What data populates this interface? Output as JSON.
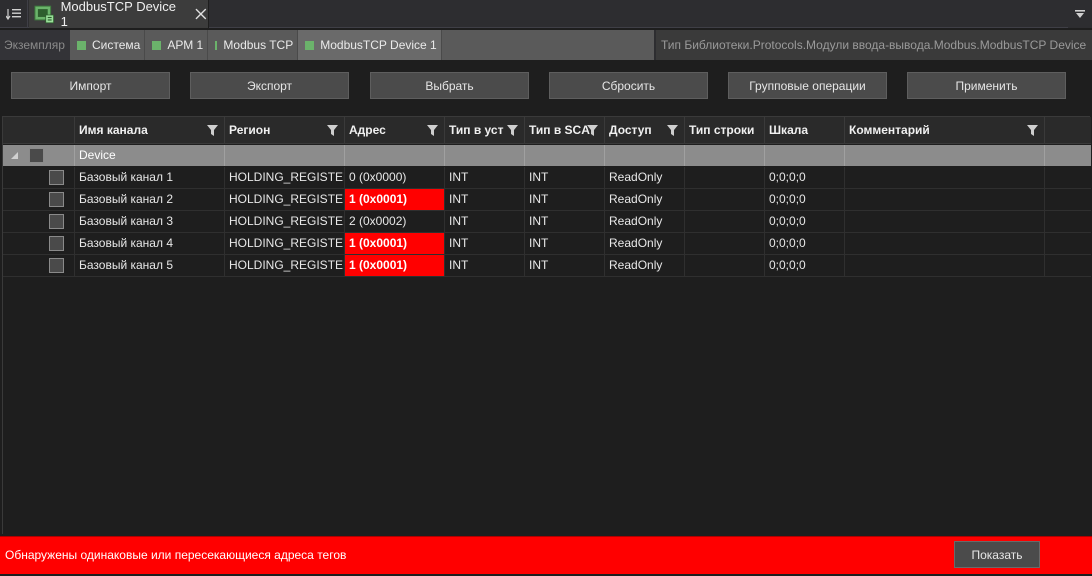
{
  "tab": {
    "title": "ModbusTCP Device 1"
  },
  "breadcrumb": {
    "label": "Экземпляр",
    "items": [
      "Система",
      "АРМ 1",
      "Modbus TCP",
      "ModbusTCP Device 1"
    ],
    "library_path": "Тип Библиотеки.Protocols.Модули ввода-вывода.Modbus.ModbusTCP Device"
  },
  "toolbar": {
    "import": "Импорт",
    "export": "Экспорт",
    "select": "Выбрать",
    "reset": "Сбросить",
    "group_ops": "Групповые операции",
    "apply": "Применить"
  },
  "grid": {
    "columns": [
      "Имя канала",
      "Регион",
      "Адрес",
      "Тип в уст",
      "Тип в SCA",
      "Доступ",
      "Тип строки",
      "Шкала",
      "Комментарий"
    ],
    "group": "Device",
    "rows": [
      {
        "name": "Базовый канал 1",
        "region": "HOLDING_REGISTERS",
        "address": "0 (0x0000)",
        "dev_type": "INT",
        "scada_type": "INT",
        "access": "ReadOnly",
        "str_type": "",
        "scale": "0;0;0;0",
        "comment": "",
        "conflict": false
      },
      {
        "name": "Базовый канал 2",
        "region": "HOLDING_REGISTERS",
        "address": "1 (0x0001)",
        "dev_type": "INT",
        "scada_type": "INT",
        "access": "ReadOnly",
        "str_type": "",
        "scale": "0;0;0;0",
        "comment": "",
        "conflict": true
      },
      {
        "name": "Базовый канал 3",
        "region": "HOLDING_REGISTERS",
        "address": "2 (0x0002)",
        "dev_type": "INT",
        "scada_type": "INT",
        "access": "ReadOnly",
        "str_type": "",
        "scale": "0;0;0;0",
        "comment": "",
        "conflict": false
      },
      {
        "name": "Базовый канал 4",
        "region": "HOLDING_REGISTERS",
        "address": "1 (0x0001)",
        "dev_type": "INT",
        "scada_type": "INT",
        "access": "ReadOnly",
        "str_type": "",
        "scale": "0;0;0;0",
        "comment": "",
        "conflict": true
      },
      {
        "name": "Базовый канал 5",
        "region": "HOLDING_REGISTERS",
        "address": "1 (0x0001)",
        "dev_type": "INT",
        "scada_type": "INT",
        "access": "ReadOnly",
        "str_type": "",
        "scale": "0;0;0;0",
        "comment": "",
        "conflict": true
      }
    ]
  },
  "status": {
    "message": "Обнаружены одинаковые или пересекающиеся адреса тегов",
    "show_button": "Показать",
    "color": "#ff0000"
  },
  "colors": {
    "accent_green": "#6bb36b",
    "error_red": "#ff0000"
  }
}
